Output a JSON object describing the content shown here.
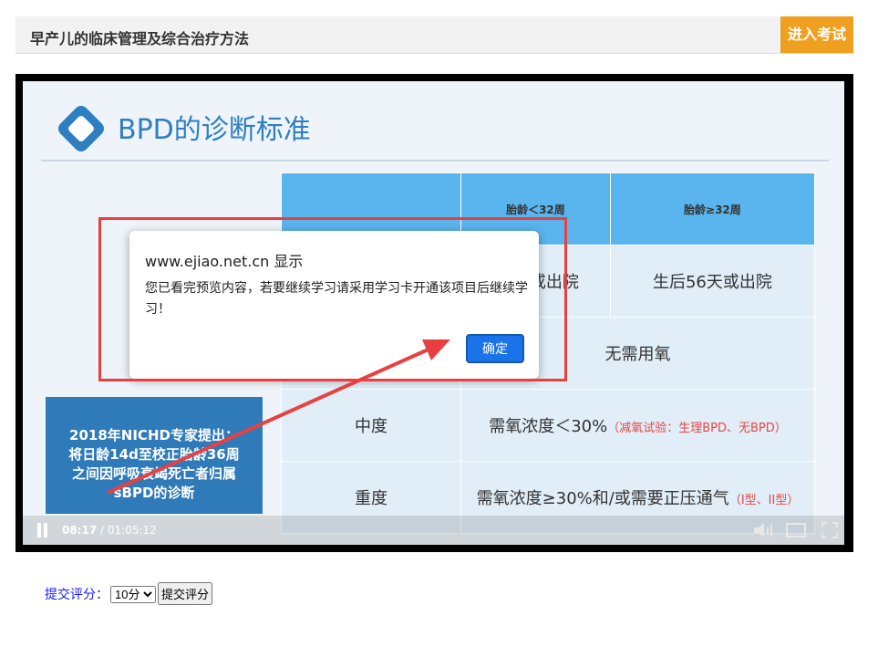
{
  "header": {
    "title": "早产儿的临床管理及综合治疗方法",
    "exam_button": "进入考试"
  },
  "slide": {
    "title": "BPD的诊断标准",
    "table": {
      "headers": [
        "",
        "胎龄＜32周",
        "胎龄≥32周"
      ],
      "rows": [
        {
          "label": "",
          "cells": [
            "36周或出院",
            "生后56天或出院"
          ]
        },
        {
          "label": "",
          "merged": "无需用氧"
        },
        {
          "label": "中度",
          "merged": "需氧浓度＜30%",
          "note": "（减氧试验：生理BPD、无BPD）"
        },
        {
          "label": "重度",
          "merged": "需氧浓度≥30%和/或需要正压通气",
          "note": "（I型、II型）"
        }
      ]
    },
    "info_box": [
      "2018年NICHD专家提出：",
      "将日龄14d至校正胎龄36周",
      "之间因呼吸衰竭死亡者归属",
      "sBPD的诊断"
    ]
  },
  "player": {
    "current_time": "08:17",
    "separator": " / ",
    "duration": "01:05:12"
  },
  "dialog": {
    "title": "www.ejiao.net.cn 显示",
    "message": "您已看完预览内容，若要继续学习请采用学习卡开通该项目后继续学习！",
    "ok_label": "确定"
  },
  "rating": {
    "label": "提交评分：",
    "selected": "10分",
    "submit_label": "提交评分"
  },
  "colors": {
    "accent": "#f0a020",
    "dialog_button": "#1a73e8",
    "annotation": "#e84040",
    "slide_header": "#5ab4ee"
  }
}
